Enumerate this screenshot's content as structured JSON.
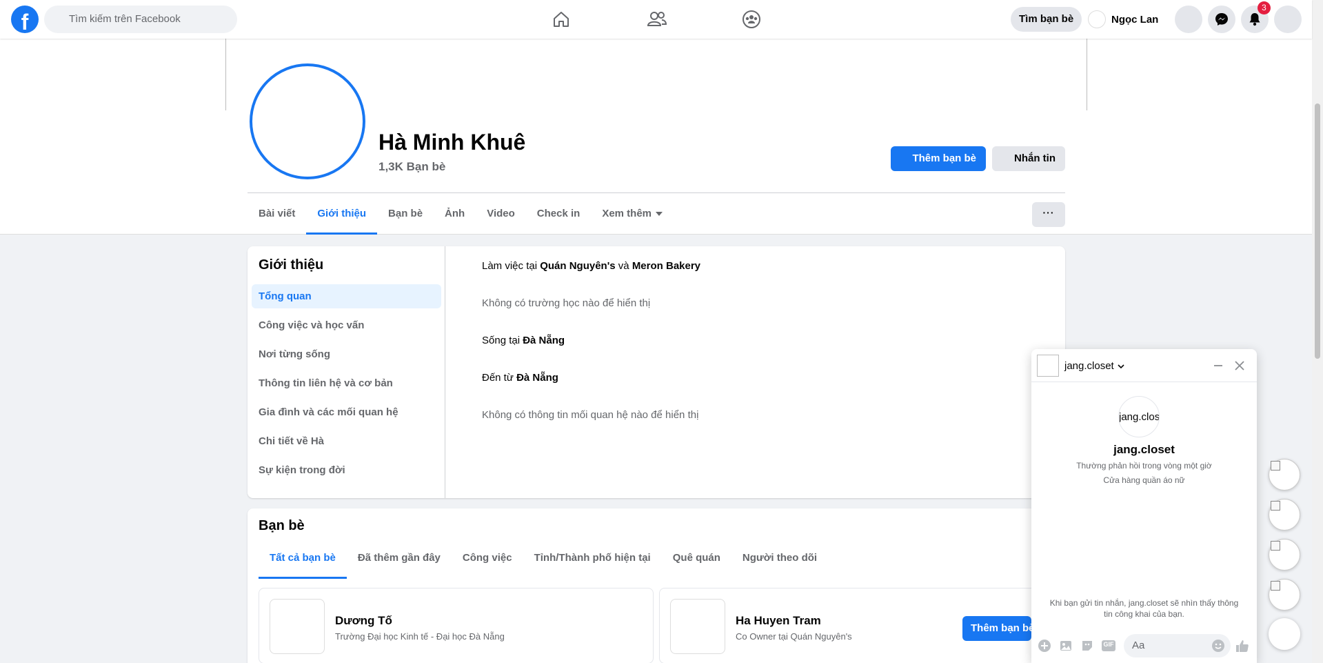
{
  "topbar": {
    "logo": "f",
    "search_placeholder": "Tìm kiếm trên Facebook",
    "find_friends": "Tìm bạn bè",
    "user_name": "Ngọc Lan",
    "notification_count": "3"
  },
  "profile": {
    "name": "Hà Minh Khuê",
    "friends_count": "1,3K Bạn bè",
    "add_friend": "Thêm bạn bè",
    "message": "Nhắn tin",
    "more_button": "···"
  },
  "tabs": [
    {
      "label": "Bài viết"
    },
    {
      "label": "Giới thiệu"
    },
    {
      "label": "Bạn bè"
    },
    {
      "label": "Ảnh"
    },
    {
      "label": "Video"
    },
    {
      "label": "Check in"
    },
    {
      "label": "Xem thêm"
    }
  ],
  "intro": {
    "title": "Giới thiệu",
    "menu": [
      "Tổng quan",
      "Công việc và học vấn",
      "Nơi từng sống",
      "Thông tin liên hệ và cơ bản",
      "Gia đình và các mối quan hệ",
      "Chi tiết về Hà",
      "Sự kiện trong đời"
    ],
    "work": {
      "prefix": "Làm việc tại ",
      "place1": "Quán Nguyên's",
      "mid": " và ",
      "place2": "Meron Bakery"
    },
    "no_school": "Không có trường học nào để hiển thị",
    "lives": {
      "prefix": "Sống tại ",
      "place": "Đà Nẵng"
    },
    "from": {
      "prefix": "Đến từ ",
      "place": "Đà Nẵng"
    },
    "no_relationship": "Không có thông tin mối quan hệ nào để hiển thị"
  },
  "friends": {
    "title": "Bạn bè",
    "tabs": [
      "Tất cả bạn bè",
      "Đã thêm gần đây",
      "Công việc",
      "Tỉnh/Thành phố hiện tại",
      "Quê quán",
      "Người theo dõi"
    ],
    "items": [
      {
        "name": "Dương Tố",
        "sub": "Trường Đại học Kinh tế - Đại học Đà Nẵng"
      },
      {
        "name": "Ha Huyen Tram",
        "sub": "Co Owner tại Quán Nguyên's"
      }
    ],
    "add_label": "Thêm bạn bè"
  },
  "chat": {
    "name": "jang.closet",
    "avatar_alt": "jang.clos",
    "title": "jang.closet",
    "response": "Thường phản hồi trong vòng một giờ",
    "category": "Cửa hàng quần áo nữ",
    "notice": "Khi bạn gửi tin nhắn, jang.closet sẽ nhìn thấy thông tin công khai của bạn.",
    "input_placeholder": "Aa",
    "gif_label": "GIF"
  },
  "colors": {
    "brand": "#1877f2",
    "badge": "#e41e3f"
  }
}
